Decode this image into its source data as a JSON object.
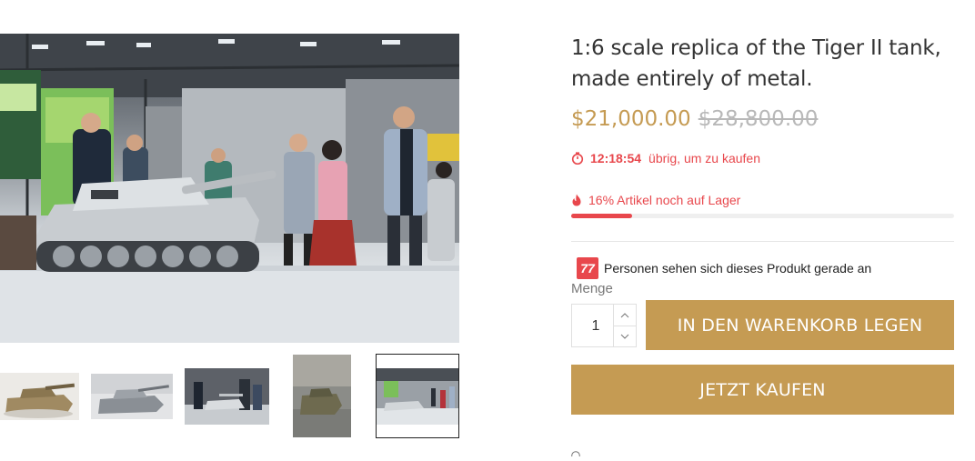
{
  "product": {
    "title_line1": "1:6 scale replica of the Tiger II tank,",
    "title_line2": "made entirely of metal.",
    "price_current": "$21,000.00",
    "price_original": "$28,800.00"
  },
  "countdown": {
    "time": "12:18:54",
    "suffix": "übrig, um zu kaufen",
    "icon": "stopwatch-icon"
  },
  "stock": {
    "text": "16% Artikel noch auf Lager",
    "percent_remaining": 16,
    "icon": "flame-icon"
  },
  "viewers": {
    "count": "77",
    "text": "Personen sehen sich dieses Produkt gerade an"
  },
  "quantity": {
    "label": "Menge",
    "value": "1"
  },
  "buttons": {
    "add_to_cart": "IN DEN WARENKORB LEGEN",
    "buy_now": "JETZT KAUFEN"
  },
  "gallery": {
    "thumbnail_count": 5,
    "active_thumbnail": 5
  },
  "colors": {
    "accent_gold": "#c59b53",
    "alert_red": "#e8474c",
    "price_old_gray": "#b8b8b8"
  }
}
